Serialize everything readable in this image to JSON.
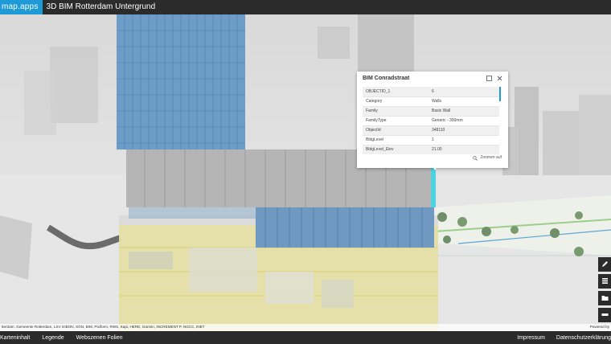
{
  "header": {
    "logo": "map.apps",
    "title": "3D BIM Rotterdam Untergrund"
  },
  "popup": {
    "title": "BIM Conradstraat",
    "rows": [
      {
        "key": "OBJECTID_1",
        "value": "6"
      },
      {
        "key": "Category",
        "value": "Walls"
      },
      {
        "key": "Family",
        "value": "Basic Wall"
      },
      {
        "key": "FamilyType",
        "value": "Generic - 300mm"
      },
      {
        "key": "ObjectId",
        "value": "348110"
      },
      {
        "key": "BldgLevel",
        "value": "1"
      },
      {
        "key": "BldgLevel_Elev",
        "value": "21.00"
      }
    ],
    "zoom_label": "Zoomen auf"
  },
  "attribution": {
    "text": "tterdam, Gemeente Rotterdam, LSV GIBON, SGN, BIM, Pixiform, RWS, Kapi, HERE, Garmin, INCREMENT P, NGCC, INET",
    "powered": "Powered by"
  },
  "footer": {
    "left": [
      "Karteninhalt",
      "Legende",
      "Webszenen Folien"
    ],
    "right": [
      "Impressum",
      "Datenschutzerklärung"
    ]
  },
  "colors": {
    "header_bg": "#2b2b2b",
    "accent": "#1e9ad6"
  },
  "icons": [
    "maximize-icon",
    "close-icon",
    "zoom-in-icon",
    "pencil-icon",
    "layers-icon",
    "folder-icon",
    "measure-icon"
  ]
}
